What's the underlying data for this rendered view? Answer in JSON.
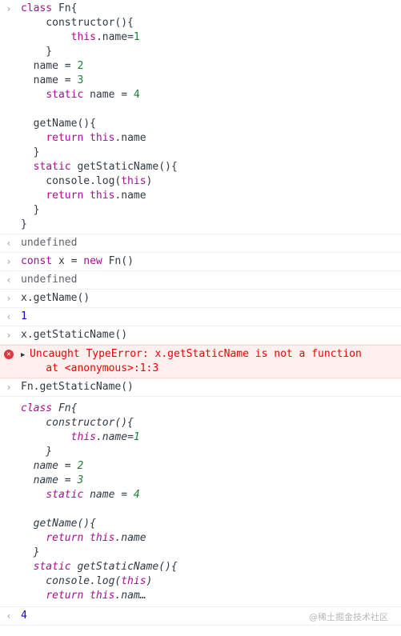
{
  "entries": [
    {
      "kind": "input",
      "gutter": "›",
      "lines": [
        "class Fn{",
        "    constructor(){",
        "        this.name=1",
        "    }",
        "  name = 2",
        "  name = 3",
        "    static name = 4",
        "",
        "  getName(){",
        "    return this.name",
        "  }",
        "  static getStaticName(){",
        "    console.log(this)",
        "    return this.name",
        "  }",
        "}"
      ]
    },
    {
      "kind": "output",
      "gutter": "‹",
      "lines": [
        "undefined"
      ]
    },
    {
      "kind": "input",
      "gutter": "›",
      "lines": [
        "const x = new Fn()"
      ]
    },
    {
      "kind": "output",
      "gutter": "‹",
      "lines": [
        "undefined"
      ]
    },
    {
      "kind": "input",
      "gutter": "›",
      "lines": [
        "x.getName()"
      ]
    },
    {
      "kind": "output",
      "gutter": "‹",
      "lines": [
        "1"
      ]
    },
    {
      "kind": "input",
      "gutter": "›",
      "lines": [
        "x.getStaticName()"
      ]
    },
    {
      "kind": "error",
      "gutter": "✕",
      "lines": [
        "Uncaught TypeError: x.getStaticName is not a function",
        "    at <anonymous>:1:3"
      ]
    },
    {
      "kind": "input",
      "gutter": "›",
      "lines": [
        "Fn.getStaticName()"
      ]
    },
    {
      "kind": "log",
      "gutter": "",
      "lines": [
        "class Fn{",
        "    constructor(){",
        "        this.name=1",
        "    }",
        "  name = 2",
        "  name = 3",
        "    static name = 4",
        "",
        "  getName(){",
        "    return this.name",
        "  }",
        "  static getStaticName(){",
        "    console.log(this)",
        "    return this.nam…"
      ]
    },
    {
      "kind": "output",
      "gutter": "‹",
      "lines": [
        "4"
      ]
    }
  ],
  "watermark": "@稀土掘金技术社区",
  "colors": {
    "keyword": "#aa0d91",
    "number_output": "#1c00cf",
    "number_code": "#1a7f37",
    "error_text": "#ee0000",
    "error_bg": "#fff0f0"
  }
}
